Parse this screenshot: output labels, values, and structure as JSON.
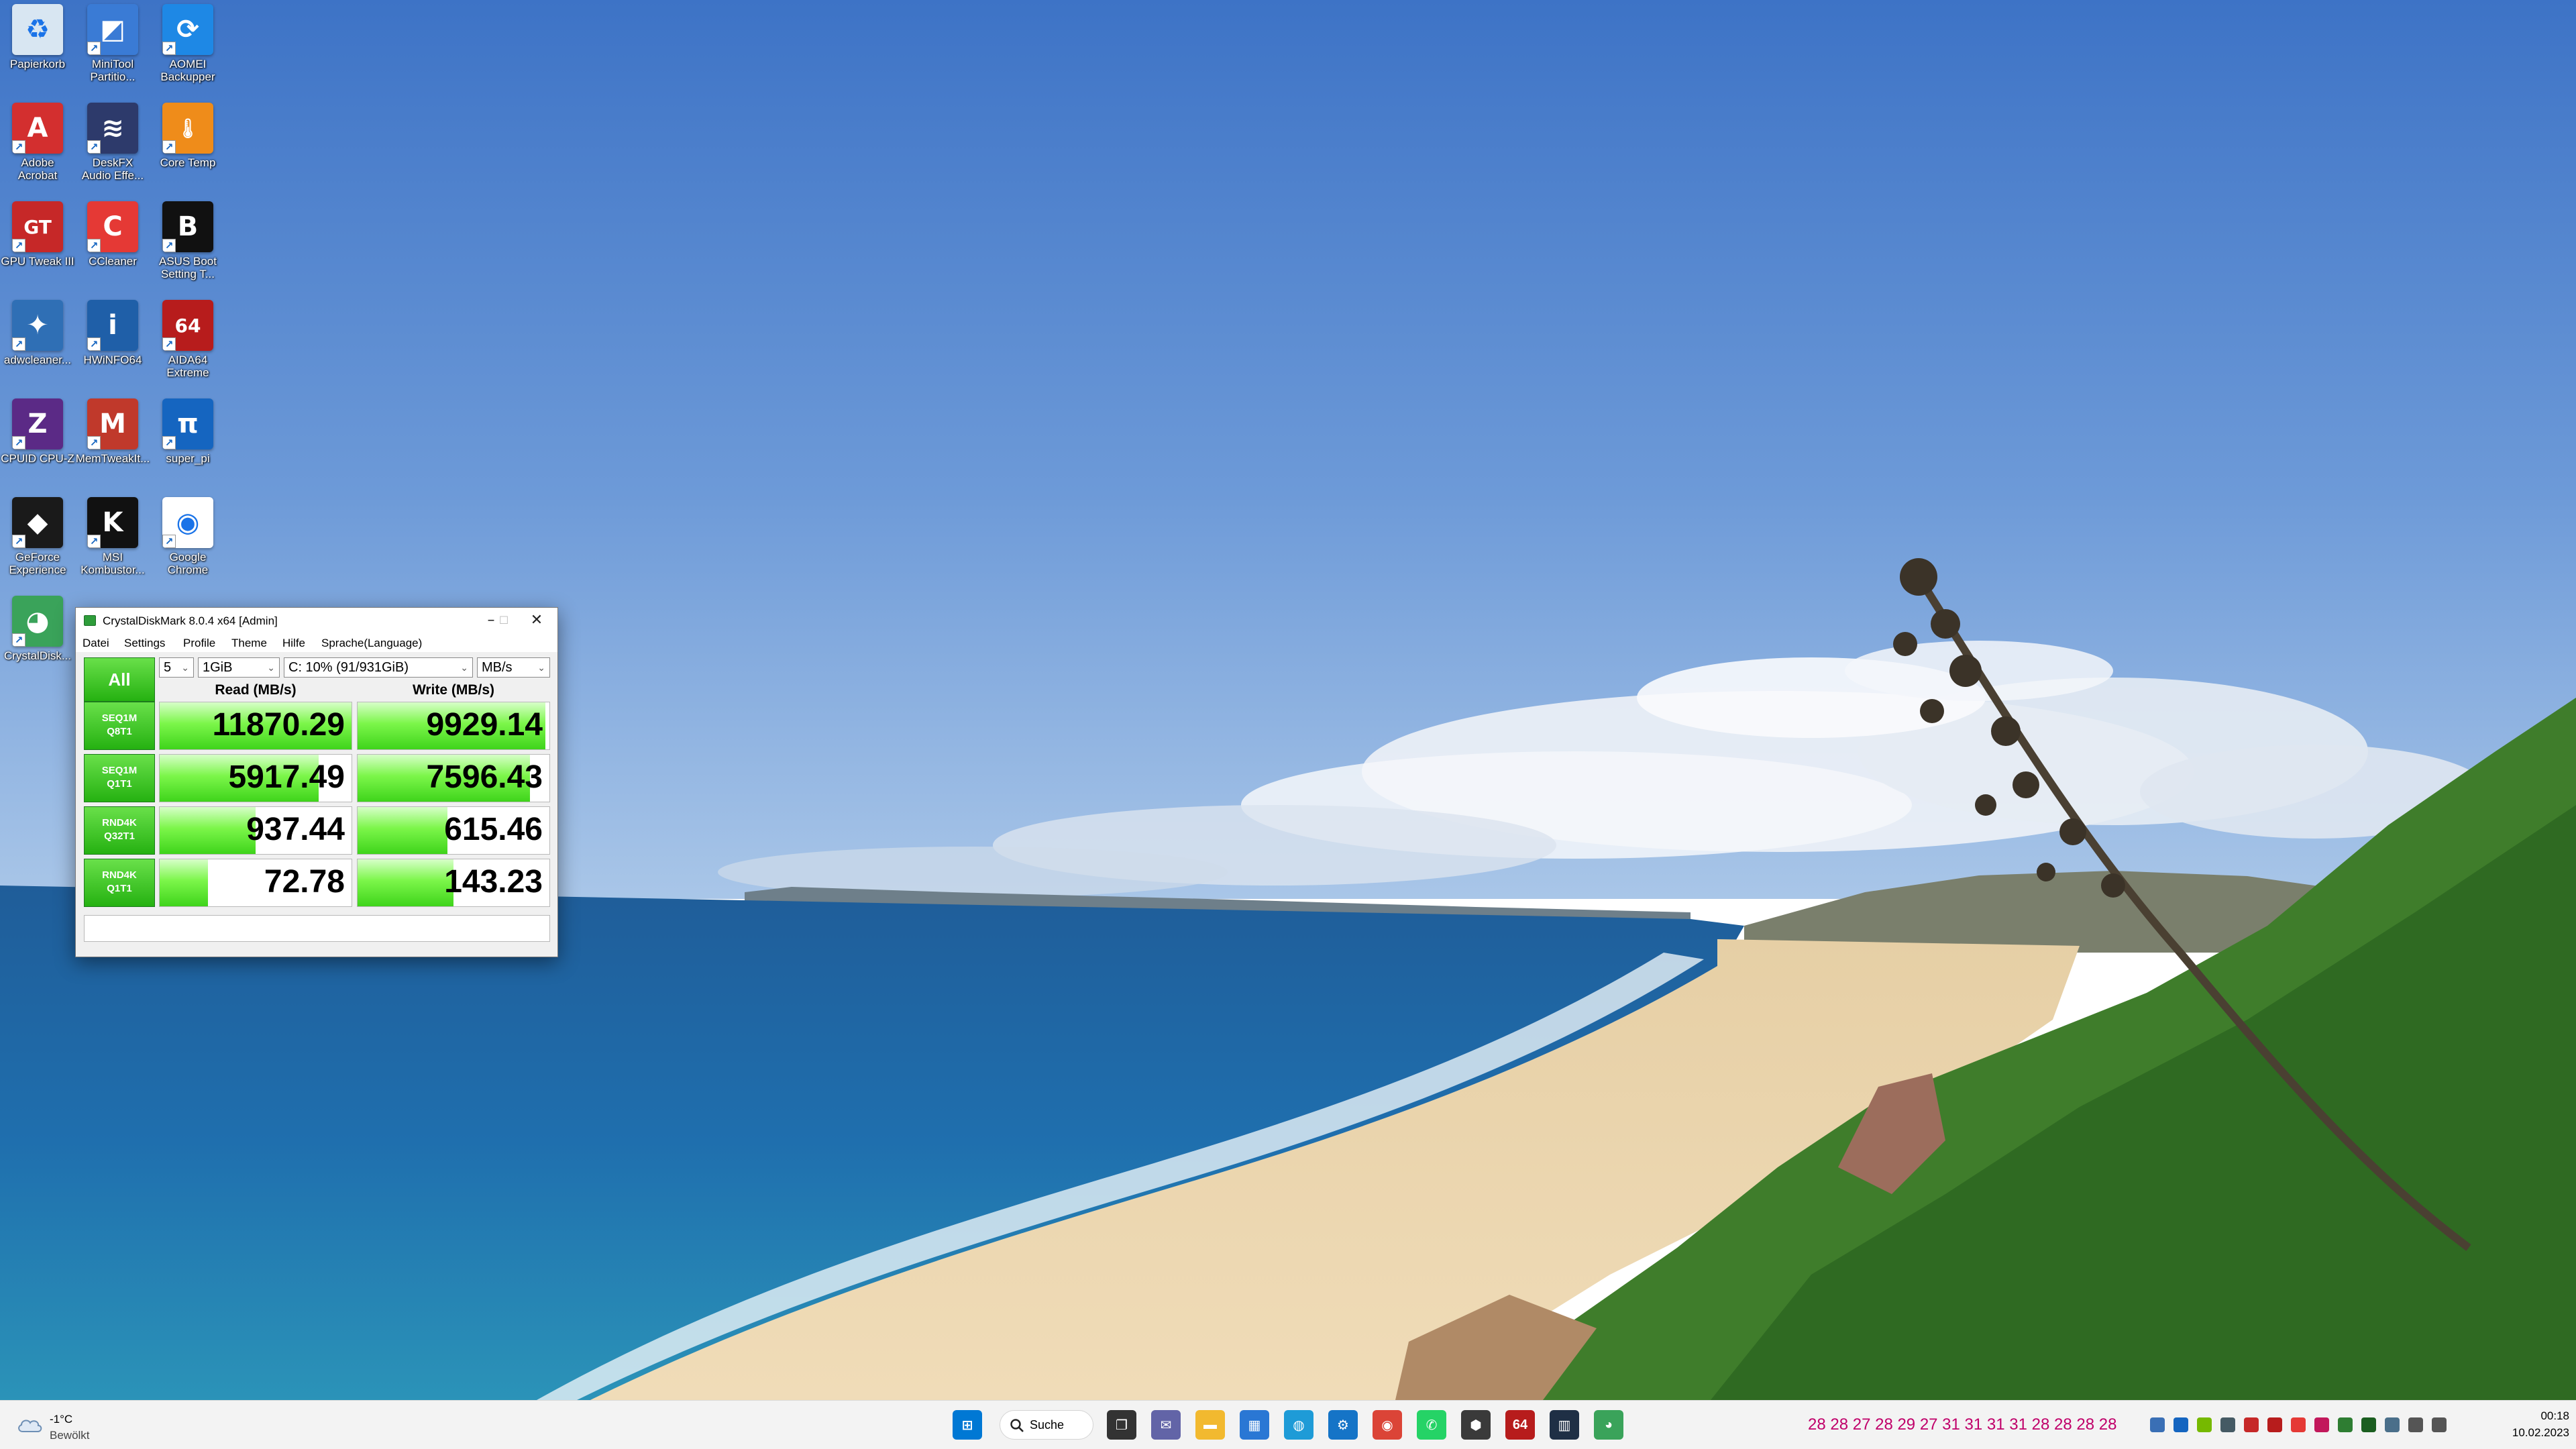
{
  "desktop_icons": [
    {
      "label": "Papierkorb",
      "icon": "recycle-bin-icon",
      "color": "#d8e6f2"
    },
    {
      "label": "MiniTool\nPartitio...",
      "icon": "minitool-partition-icon",
      "color": "#3a7bd5"
    },
    {
      "label": "AOMEI\nBackupper",
      "icon": "aomei-backupper-icon",
      "color": "#1e88e5"
    },
    {
      "label": "Adobe\nAcrobat",
      "icon": "adobe-acrobat-icon",
      "color": "#d32f2f"
    },
    {
      "label": "DeskFX\nAudio Effe...",
      "icon": "deskfx-icon",
      "color": "#2d3a6b"
    },
    {
      "label": "Core Temp",
      "icon": "core-temp-icon",
      "color": "#ef8c1a"
    },
    {
      "label": "GPU Tweak III",
      "icon": "gpu-tweak-icon",
      "color": "#c62828"
    },
    {
      "label": "CCleaner",
      "icon": "ccleaner-icon",
      "color": "#e53935"
    },
    {
      "label": "ASUS Boot\nSetting T...",
      "icon": "asus-boot-setting-icon",
      "color": "#111111"
    },
    {
      "label": "adwcleaner...",
      "icon": "adwcleaner-icon",
      "color": "#2f6fb5"
    },
    {
      "label": "HWiNFO64",
      "icon": "hwinfo-icon",
      "color": "#1f5fa8"
    },
    {
      "label": "AIDA64\nExtreme",
      "icon": "aida64-icon",
      "color": "#b71c1c"
    },
    {
      "label": "CPUID CPU-Z",
      "icon": "cpu-z-icon",
      "color": "#5b2a86"
    },
    {
      "label": "MemTweakIt...",
      "icon": "memtweakit-icon",
      "color": "#c0392b"
    },
    {
      "label": "super_pi",
      "icon": "super-pi-icon",
      "color": "#1565c0"
    },
    {
      "label": "GeForce\nExperience",
      "icon": "geforce-experience-icon",
      "color": "#1a1a1a"
    },
    {
      "label": "MSI\nKombustor...",
      "icon": "msi-kombustor-icon",
      "color": "#111111"
    },
    {
      "label": "Google\nChrome",
      "icon": "chrome-icon",
      "color": "#ffffff"
    },
    {
      "label": "CrystalDisk...",
      "icon": "crystaldiskmark-icon",
      "color": "#3aa35a"
    }
  ],
  "cdm": {
    "title": "CrystalDiskMark 8.0.4 x64 [Admin]",
    "menu": [
      "Datei",
      "Settings",
      "Profile",
      "Theme",
      "Hilfe",
      "Sprache(Language)"
    ],
    "all_label": "All",
    "count": "5",
    "size": "1GiB",
    "drive": "C: 10% (91/931GiB)",
    "unit": "MB/s",
    "read_header": "Read (MB/s)",
    "write_header": "Write (MB/s)",
    "rows": [
      {
        "line1": "SEQ1M",
        "line2": "Q8T1",
        "read": "11870.29",
        "write": "9929.14",
        "read_fill": 1.0,
        "write_fill": 0.98
      },
      {
        "line1": "SEQ1M",
        "line2": "Q1T1",
        "read": "5917.49",
        "write": "7596.43",
        "read_fill": 0.83,
        "write_fill": 0.9
      },
      {
        "line1": "RND4K",
        "line2": "Q32T1",
        "read": "937.44",
        "write": "615.46",
        "read_fill": 0.5,
        "write_fill": 0.47
      },
      {
        "line1": "RND4K",
        "line2": "Q1T1",
        "read": "72.78",
        "write": "143.23",
        "read_fill": 0.25,
        "write_fill": 0.5
      }
    ],
    "accent": "#3fd41b"
  },
  "taskbar": {
    "weather_temp": "-1°C",
    "weather_cond": "Bewölkt",
    "search_label": "Suche",
    "pinned": [
      {
        "icon": "start-icon",
        "color": "#0078d4"
      },
      {
        "icon": "task-view-icon",
        "color": "#333333"
      },
      {
        "icon": "teams-chat-icon",
        "color": "#6264a7"
      },
      {
        "icon": "file-explorer-icon",
        "color": "#f2b92f"
      },
      {
        "icon": "microsoft-store-icon",
        "color": "#2a77d4"
      },
      {
        "icon": "network-globe-icon",
        "color": "#1e9bd7"
      },
      {
        "icon": "settings-app-icon",
        "color": "#1574c7"
      },
      {
        "icon": "chrome-icon",
        "color": "#db4437"
      },
      {
        "icon": "whatsapp-icon",
        "color": "#25d366"
      },
      {
        "icon": "cube-app-icon",
        "color": "#3a3a3a"
      },
      {
        "icon": "aida64-icon",
        "color": "#b71c1c",
        "text": "64"
      },
      {
        "icon": "hwinfo-icon",
        "color": "#1f2f45"
      },
      {
        "icon": "crystaldiskmark-icon",
        "color": "#3aa35a"
      }
    ],
    "tray_numbers": "28 28 27 28 29 27 31 31 31 31 28 28 28 28",
    "tray_icons": [
      {
        "icon": "hwinfo-tray-icon",
        "color": "#3a6fb5"
      },
      {
        "icon": "bluetooth-icon",
        "color": "#1565c0"
      },
      {
        "icon": "nvidia-tray-icon",
        "color": "#76b900"
      },
      {
        "icon": "shield-tray-icon",
        "color": "#455a64"
      },
      {
        "icon": "msi-tray-icon",
        "color": "#c62828"
      },
      {
        "icon": "aida64-tray-icon",
        "color": "#b71c1c"
      },
      {
        "icon": "record-tray-icon",
        "color": "#e53935"
      },
      {
        "icon": "gpu-tray-icon",
        "color": "#c2185b"
      },
      {
        "icon": "hwmonitor-tray-icon",
        "color": "#2e7d32"
      },
      {
        "icon": "network-tray-icon",
        "color": "#1b5e20"
      },
      {
        "icon": "display-tray-icon",
        "color": "#4a6f8a"
      },
      {
        "icon": "battery-icon",
        "color": "#555555"
      },
      {
        "icon": "volume-icon",
        "color": "#555555"
      }
    ],
    "time": "00:18",
    "date": "10.02.2023"
  }
}
